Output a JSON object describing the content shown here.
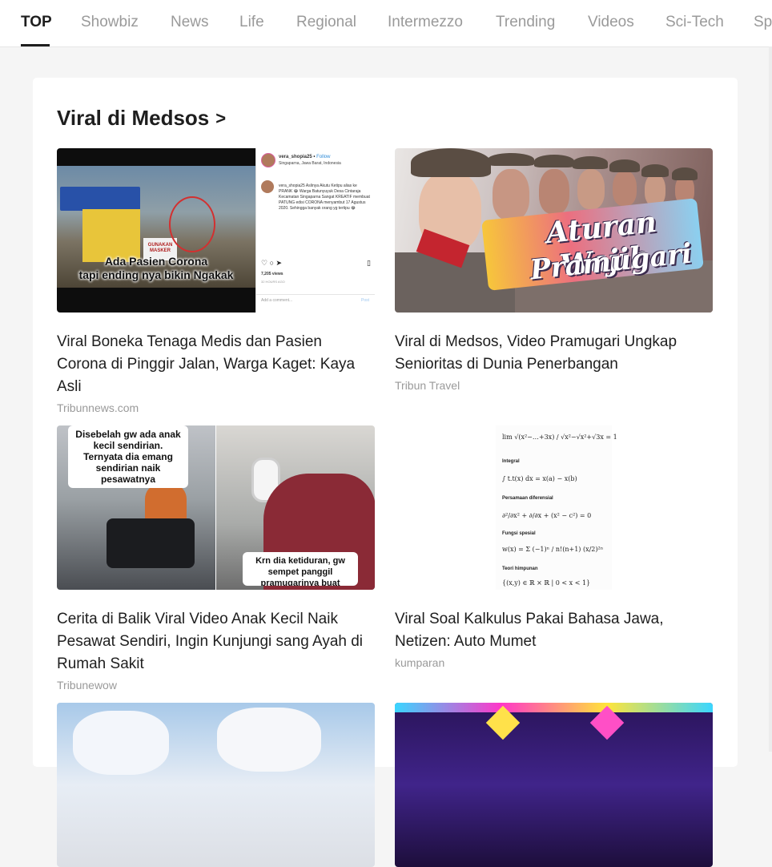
{
  "tabs": [
    {
      "label": "TOP",
      "active": true
    },
    {
      "label": "Showbiz",
      "active": false
    },
    {
      "label": "News",
      "active": false
    },
    {
      "label": "Life",
      "active": false
    },
    {
      "label": "Regional",
      "active": false
    },
    {
      "label": "Intermezzo",
      "active": false
    },
    {
      "label": "Trending",
      "active": false
    },
    {
      "label": "Videos",
      "active": false
    },
    {
      "label": "Sci-Tech",
      "active": false
    },
    {
      "label": "Sp",
      "active": false
    }
  ],
  "section": {
    "title": "Viral di Medsos",
    "chevron": ">"
  },
  "articles": [
    {
      "headline": "Viral Boneka Tenaga Medis dan Pasien Corona di Pinggir Jalan, Warga Kaget: Kaya Asli",
      "source": "Tribunnews.com",
      "thumb": {
        "caption_line1": "Ada Pasien Corona",
        "caption_line2": "tapi ending nya bikin Ngakak",
        "sign_text": "GUNAKAN MASKER",
        "ig_user": "vera_shopia25",
        "ig_follow": "Follow",
        "ig_location": "Singaparna, Jawa Barat, Indonesia",
        "ig_comment": "vera_shopia25 Aslinya Akutu Ketipu alias ke PRANK 😂 Warga Batunyuyuk Desa Cintaraja Kecamatan Singaparna Sangat KREATIF membuat PATUNG edisi CORONA menyambut 17 Agustus 2020. Sehingga banyak orang yg tertipu 😂",
        "ig_views": "7,205 views",
        "ig_ago": "32 HOURS AGO",
        "ig_add_comment": "Add a comment...",
        "ig_post": "Post"
      }
    },
    {
      "headline": "Viral di Medsos, Video Pramugari Ungkap Senioritas di Dunia Penerbangan",
      "source": "Tribun Travel",
      "thumb": {
        "line1": "Aturan Wajib",
        "line2": "Pramugari"
      }
    },
    {
      "headline": "Cerita di Balik Viral Video Anak Kecil Naik Pesawat Sendiri, Ingin Kunjungi sang Ayah di Rumah Sakit",
      "source": "Tribunewow",
      "thumb": {
        "bubble1": "Disebelah gw ada anak kecil sendirian. Ternyata dia emang sendirian naik pesawatnya",
        "bubble2": "Krn dia ketiduran, gw sempet panggil pramugarinya buat"
      }
    },
    {
      "headline": "Viral Soal Kalkulus Pakai Bahasa Jawa, Netizen: Auto Mumet",
      "source": "kumparan",
      "thumb": {
        "bullets": [
          "Integral",
          "Persamaan diferensial",
          "Fungsi spesial",
          "Teori himpunan"
        ]
      }
    }
  ],
  "colors": {
    "accent": "#1e1e1e",
    "inactive_tab": "#9a9a9a",
    "background": "#f5f5f5"
  }
}
